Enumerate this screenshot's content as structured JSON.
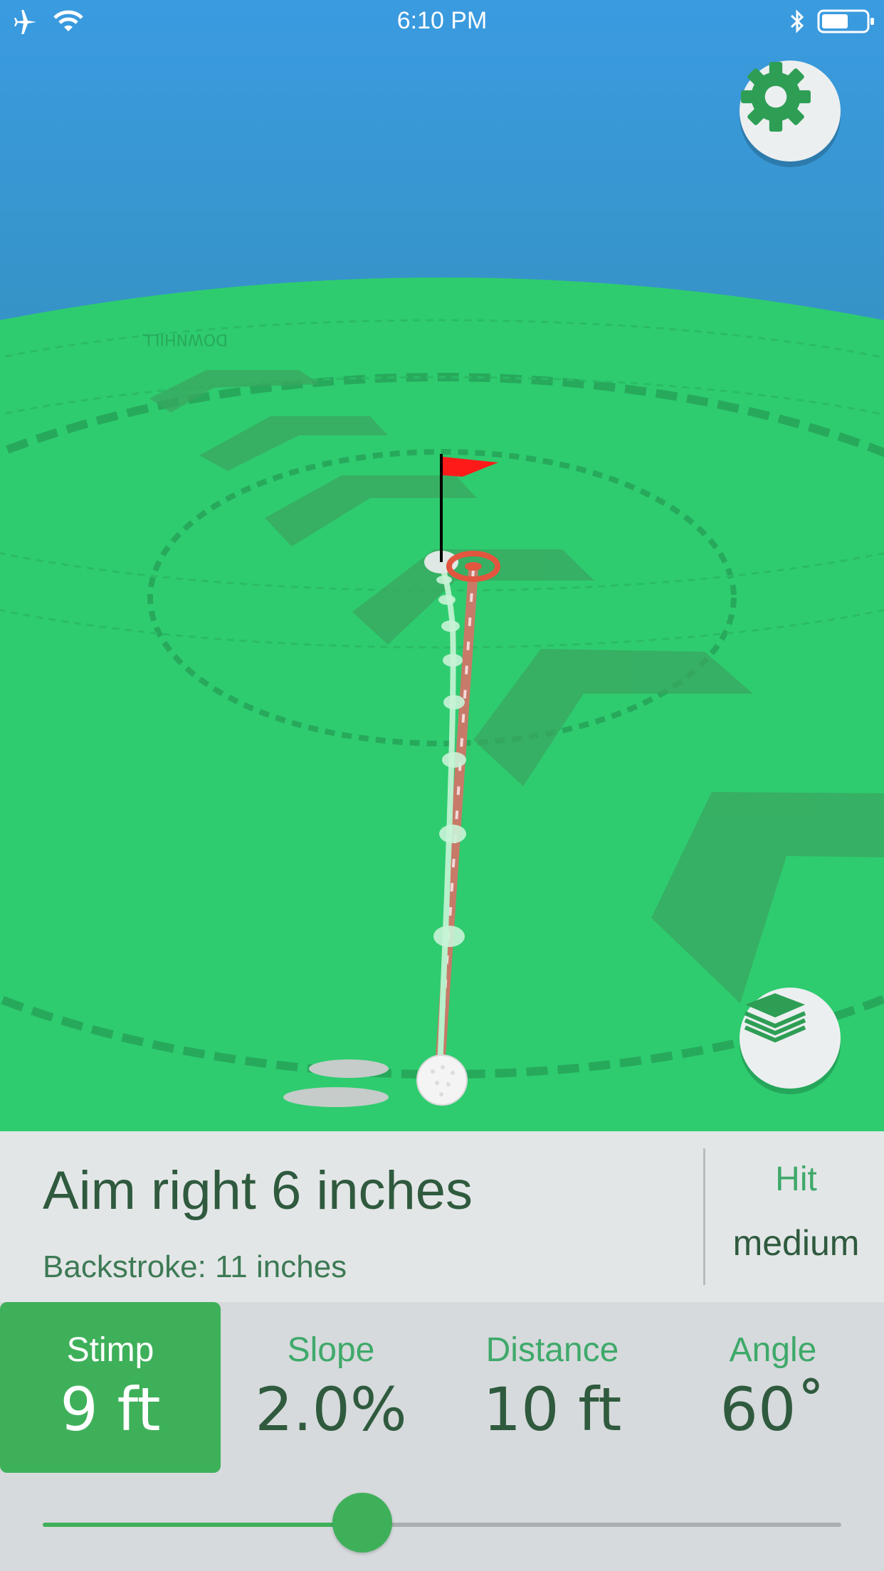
{
  "status_bar": {
    "time": "6:10 PM",
    "icons": [
      "airplane-icon",
      "wifi-icon",
      "bluetooth-icon",
      "battery-icon"
    ]
  },
  "scene": {
    "text": "DOWNHILL",
    "flag_color": "#ff1a1a",
    "green_color": "#2ecc6f",
    "sky_color": "#3a9be0"
  },
  "buttons": {
    "settings": "gear-icon",
    "layers": "layers-icon"
  },
  "info": {
    "aim": "Aim right 6 inches",
    "backstroke": "Backstroke: 11 inches",
    "hit_label": "Hit",
    "hit_value": "medium"
  },
  "stats": [
    {
      "label": "Stimp",
      "value": "9 ft",
      "active": true
    },
    {
      "label": "Slope",
      "value": "2.0%",
      "active": false
    },
    {
      "label": "Distance",
      "value": "10 ft",
      "active": false
    },
    {
      "label": "Angle",
      "value": "60˚",
      "active": false
    }
  ],
  "slider": {
    "fraction": 0.4
  },
  "colors": {
    "accent": "#3fb05a",
    "text_dark": "#2f5a3e",
    "panel_bg": "#e3e6e7"
  }
}
